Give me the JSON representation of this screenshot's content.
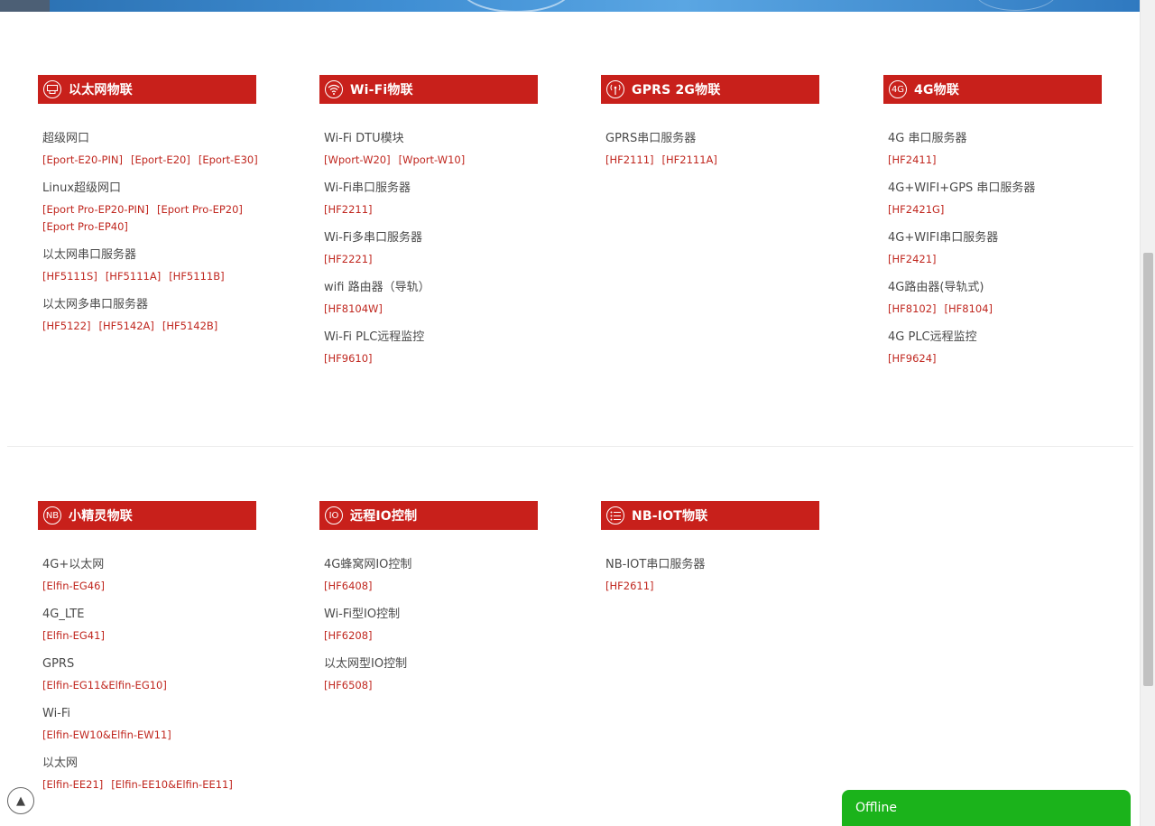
{
  "sections": [
    {
      "columns": [
        {
          "icon": "ethernet-icon",
          "icon_text": "",
          "title": "以太网物联",
          "items": [
            {
              "name": "超级网口",
              "models": [
                "[Eport-E20-PIN]",
                "[Eport-E20]",
                "[Eport-E30]"
              ]
            },
            {
              "name": "Linux超级网口",
              "models": [
                "[Eport Pro-EP20-PIN]",
                "[Eport Pro-EP20]",
                "[Eport Pro-EP40]"
              ]
            },
            {
              "name": "以太网串口服务器",
              "models": [
                "[HF5111S]",
                "[HF5111A]",
                "[HF5111B]"
              ]
            },
            {
              "name": "以太网多串口服务器",
              "models": [
                "[HF5122]",
                "[HF5142A]",
                "[HF5142B]"
              ]
            }
          ]
        },
        {
          "icon": "wifi-icon",
          "icon_text": "",
          "title": "Wi-Fi物联",
          "items": [
            {
              "name": "Wi-Fi DTU模块",
              "models": [
                "[Wport-W20]",
                "[Wport-W10]"
              ]
            },
            {
              "name": "Wi-Fi串口服务器",
              "models": [
                "[HF2211]"
              ]
            },
            {
              "name": "Wi-Fi多串口服务器",
              "models": [
                "[HF2221]"
              ]
            },
            {
              "name": "wifi 路由器（导轨）",
              "models": [
                "[HF8104W]"
              ]
            },
            {
              "name": "Wi-Fi PLC远程监控",
              "models": [
                "[HF9610]"
              ]
            }
          ]
        },
        {
          "icon": "antenna-icon",
          "icon_text": "",
          "title": "GPRS 2G物联",
          "items": [
            {
              "name": "GPRS串口服务器",
              "models": [
                "[HF2111]",
                "[HF2111A]"
              ]
            }
          ]
        },
        {
          "icon": "4g-icon",
          "icon_text": "4G",
          "title": "4G物联",
          "items": [
            {
              "name": "4G 串口服务器",
              "models": [
                "[HF2411]"
              ]
            },
            {
              "name": "4G+WIFI+GPS 串口服务器",
              "models": [
                "[HF2421G]"
              ]
            },
            {
              "name": "4G+WIFI串口服务器",
              "models": [
                "[HF2421]"
              ]
            },
            {
              "name": "4G路由器(导轨式)",
              "models": [
                "[HF8102]",
                "[HF8104]"
              ]
            },
            {
              "name": "4G PLC远程监控",
              "models": [
                "[HF9624]"
              ]
            }
          ]
        }
      ]
    },
    {
      "columns": [
        {
          "icon": "nb-icon",
          "icon_text": "NB",
          "title": "小精灵物联",
          "items": [
            {
              "name": "4G+以太网",
              "models": [
                "[Elfin-EG46]"
              ]
            },
            {
              "name": "4G_LTE",
              "models": [
                "[Elfin-EG41]"
              ]
            },
            {
              "name": "GPRS",
              "models": [
                "[Elfin-EG11&Elfin-EG10]"
              ]
            },
            {
              "name": "Wi-Fi",
              "models": [
                "[Elfin-EW10&Elfin-EW11]"
              ]
            },
            {
              "name": "以太网",
              "models": [
                "[Elfin-EE21]",
                "[Elfin-EE10&Elfin-EE11]"
              ]
            }
          ]
        },
        {
          "icon": "io-icon",
          "icon_text": "IO",
          "title": "远程IO控制",
          "items": [
            {
              "name": "4G蜂窝网IO控制",
              "models": [
                "[HF6408]"
              ]
            },
            {
              "name": "Wi-Fi型IO控制",
              "models": [
                "[HF6208]"
              ]
            },
            {
              "name": "以太网型IO控制",
              "models": [
                "[HF6508]"
              ]
            }
          ]
        },
        {
          "icon": "list-icon",
          "icon_text": "",
          "title": "NB-IOT物联",
          "items": [
            {
              "name": "NB-IOT串口服务器",
              "models": [
                "[HF2611]"
              ]
            }
          ]
        }
      ]
    }
  ],
  "chat": {
    "label": "Offline"
  },
  "colors": {
    "accent": "#c8201b",
    "chat": "#1bb31b"
  }
}
